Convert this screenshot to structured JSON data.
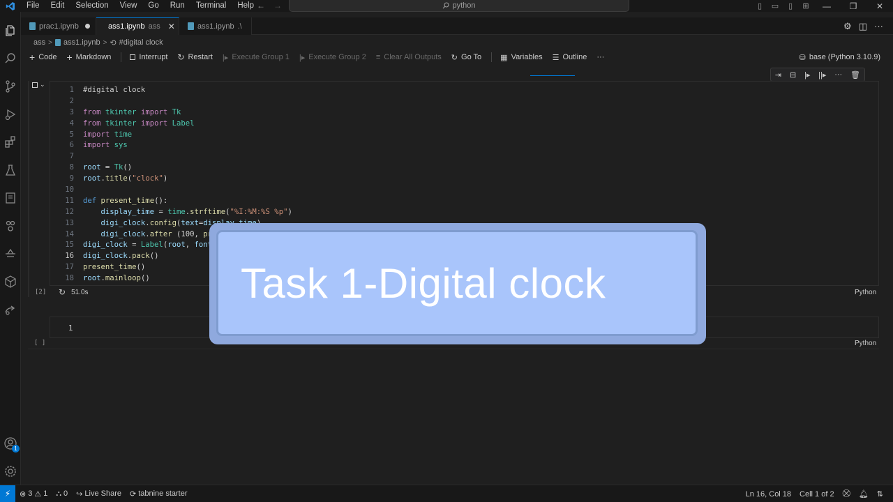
{
  "menu": [
    "File",
    "Edit",
    "Selection",
    "View",
    "Go",
    "Run",
    "Terminal",
    "Help"
  ],
  "command_center": "python",
  "tabs": [
    {
      "label": "prac1.ipynb",
      "sub": "",
      "modified": true,
      "active": false
    },
    {
      "label": "ass1.ipynb",
      "sub": "ass",
      "modified": false,
      "active": true
    },
    {
      "label": "ass1.ipynb",
      "sub": ".\\",
      "modified": false,
      "active": false
    }
  ],
  "breadcrumb": [
    "ass",
    "ass1.ipynb",
    "#digital clock"
  ],
  "toolbar": {
    "code": "Code",
    "markdown": "Markdown",
    "interrupt": "Interrupt",
    "restart": "Restart",
    "execute_group_1": "Execute Group 1",
    "execute_group_2": "Execute Group 2",
    "clear_all_outputs": "Clear All Outputs",
    "go_to": "Go To",
    "variables": "Variables",
    "outline": "Outline",
    "more": "···",
    "kernel": "base (Python 3.10.9)"
  },
  "cell1": {
    "exec_count": "[2]",
    "duration": "51.0s",
    "language": "Python",
    "current_line": 16
  },
  "cell2": {
    "line_number": "1",
    "exec_count": "[ ]",
    "language": "Python"
  },
  "banner": {
    "text": "Task 1-Digital clock"
  },
  "statusbar": {
    "errors": "3",
    "warnings": "1",
    "ports": "0",
    "live_share": "Live Share",
    "tabnine": "tabnine starter",
    "cursor": "Ln 16, Col 18",
    "cell": "Cell 1 of 2",
    "accounts_badge": "1"
  },
  "colors": {
    "accent": "#0078d4",
    "banner_bg": "#a9c5fb",
    "editor_bg": "#1f1f1f"
  }
}
